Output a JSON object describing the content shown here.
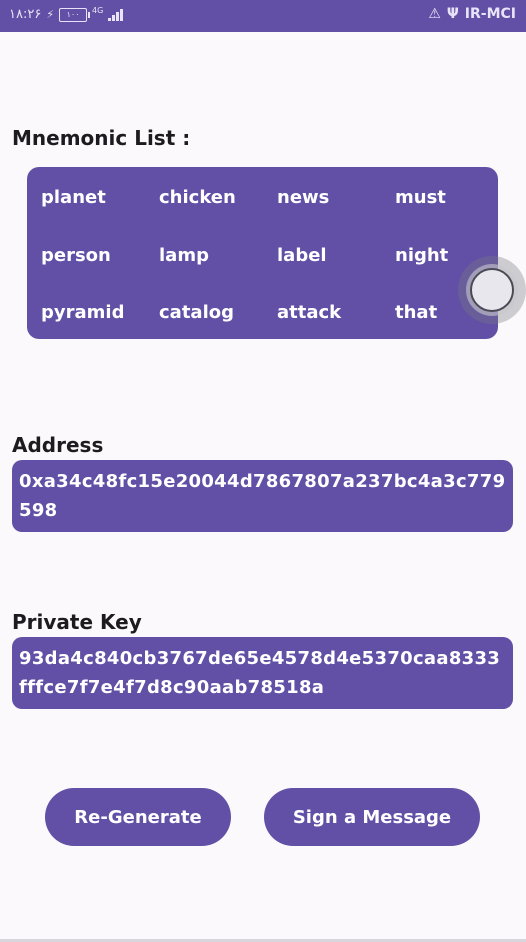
{
  "status_bar": {
    "time": "۱۸:۲۶",
    "battery": "۱۰۰",
    "network": "4G",
    "carrier": "IR-MCI"
  },
  "mnemonic": {
    "title": "Mnemonic List :",
    "words": [
      "planet",
      "chicken",
      "news",
      "must",
      "person",
      "lamp",
      "label",
      "night",
      "pyramid",
      "catalog",
      "attack",
      "that"
    ]
  },
  "address": {
    "title": "Address",
    "value": "0xa34c48fc15e20044d7867807a237bc4a3c779598"
  },
  "private_key": {
    "title": "Private Key",
    "value": "93da4c840cb3767de65e4578d4e5370caa8333fffce7f7e4f7d8c90aab78518a"
  },
  "buttons": {
    "regenerate": "Re-Generate",
    "sign": "Sign a Message"
  },
  "colors": {
    "primary": "#6250a6",
    "background": "#fbf9fb",
    "text": "#1d1b20"
  }
}
